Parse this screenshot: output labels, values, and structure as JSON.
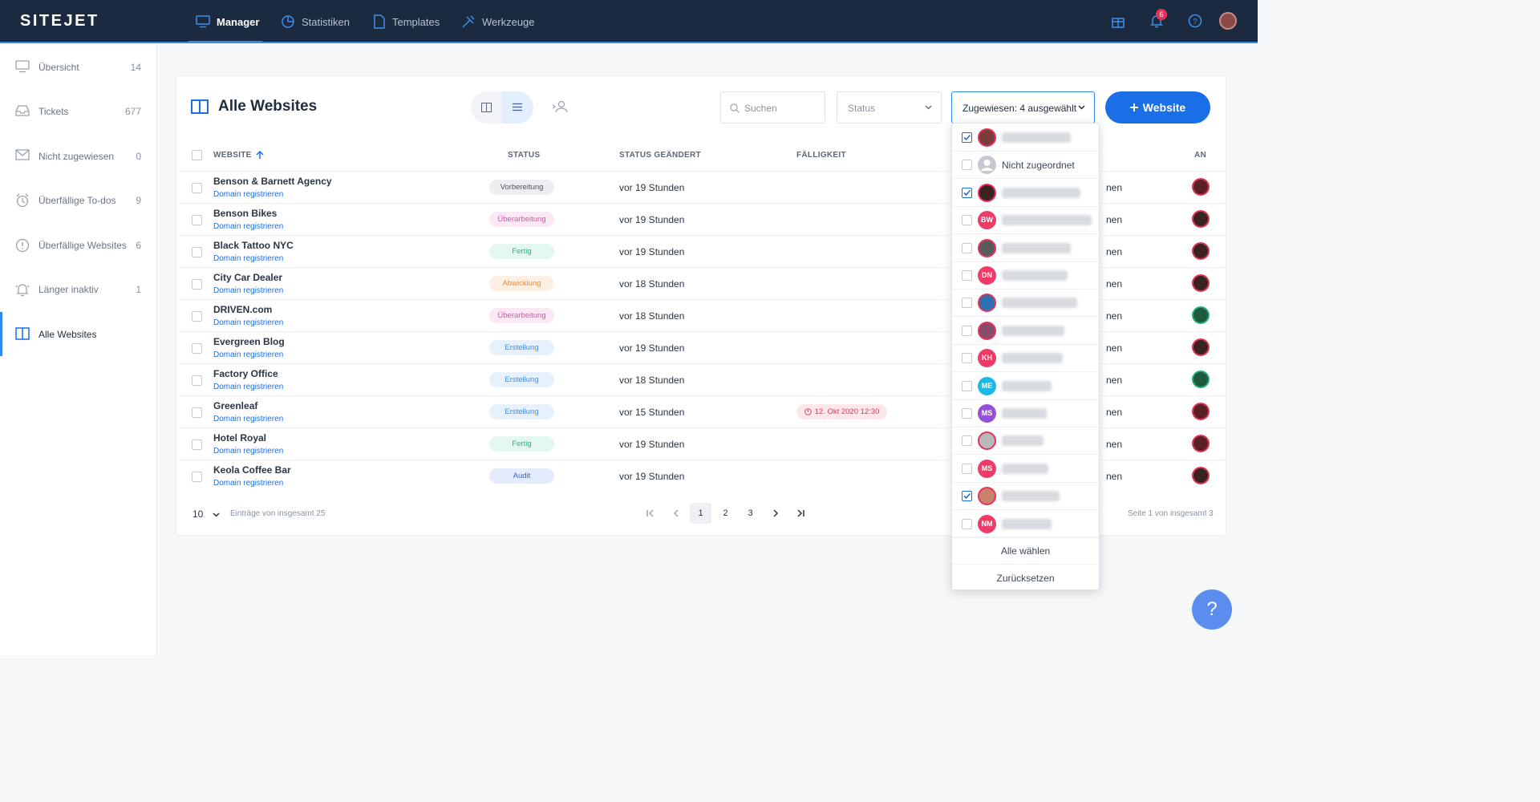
{
  "app": {
    "logo": "SITEJET"
  },
  "nav": [
    {
      "label": "Manager",
      "active": true
    },
    {
      "label": "Statistiken"
    },
    {
      "label": "Templates"
    },
    {
      "label": "Werkzeuge"
    }
  ],
  "header": {
    "notification_count": "6"
  },
  "sidebar": {
    "items": [
      {
        "label": "Übersicht",
        "count": "14",
        "icon": "monitor-icon"
      },
      {
        "label": "Tickets",
        "count": "677",
        "icon": "inbox-icon"
      },
      {
        "label": "Nicht zugewiesen",
        "count": "0",
        "icon": "mail-icon"
      },
      {
        "label": "Überfällige To-dos",
        "count": "9",
        "icon": "alarm-clock-icon"
      },
      {
        "label": "Überfällige Websites",
        "count": "6",
        "icon": "alert-circle-icon"
      },
      {
        "label": "Länger inaktiv",
        "count": "1",
        "icon": "bell-icon"
      },
      {
        "label": "Alle Websites",
        "count": "",
        "icon": "columns-icon",
        "active": true
      }
    ]
  },
  "main": {
    "title": "Alle Websites",
    "search_placeholder": "Suchen",
    "status_filter": "Status",
    "assign_filter": "Zugewiesen: 4 ausgewählt",
    "add_button": "Website",
    "columns": {
      "website": "WEBSITE",
      "status": "STATUS",
      "changed": "STATUS GEÄNDERT",
      "due": "FÄLLIGKEIT",
      "assigned": "AN"
    },
    "rows": [
      {
        "name": "Benson & Barnett Agency",
        "domain": "Domain registrieren",
        "status": "Vorbereitung",
        "changed": "vor 19 Stunden",
        "due": "",
        "partial": "nen"
      },
      {
        "name": "Benson Bikes",
        "domain": "Domain registrieren",
        "status": "Überarbeitung",
        "changed": "vor 19 Stunden",
        "due": "",
        "partial": "nen"
      },
      {
        "name": "Black Tattoo NYC",
        "domain": "Domain registrieren",
        "status": "Fertig",
        "changed": "vor 19 Stunden",
        "due": "",
        "partial": "nen"
      },
      {
        "name": "City Car Dealer",
        "domain": "Domain registrieren",
        "status": "Abwicklung",
        "changed": "vor 18 Stunden",
        "due": "",
        "partial": "nen"
      },
      {
        "name": "DRIVEN.com",
        "domain": "Domain registrieren",
        "status": "Überarbeitung",
        "changed": "vor 18 Stunden",
        "due": "",
        "partial": "nen"
      },
      {
        "name": "Evergreen Blog",
        "domain": "Domain registrieren",
        "status": "Erstellung",
        "changed": "vor 19 Stunden",
        "due": "",
        "partial": "nen"
      },
      {
        "name": "Factory Office",
        "domain": "Domain registrieren",
        "status": "Erstellung",
        "changed": "vor 18 Stunden",
        "due": "",
        "partial": "nen"
      },
      {
        "name": "Greenleaf",
        "domain": "Domain registrieren",
        "status": "Erstellung",
        "changed": "vor 15 Stunden",
        "due": "12. Okt 2020 12:30",
        "partial": "nen"
      },
      {
        "name": "Hotel Royal",
        "domain": "Domain registrieren",
        "status": "Fertig",
        "changed": "vor 19 Stunden",
        "due": "",
        "partial": "nen"
      },
      {
        "name": "Keola Coffee Bar",
        "domain": "Domain registrieren",
        "status": "Audit",
        "changed": "vor 19 Stunden",
        "due": "",
        "partial": "nen"
      }
    ],
    "pagination": {
      "per_page": "10",
      "total_text": "Einträge von insgesamt 25",
      "pages": [
        "1",
        "2",
        "3"
      ],
      "page_info": "Seite 1 von insgesamt 3"
    }
  },
  "status_colors": {
    "Vorbereitung": {
      "bg": "#eceef1",
      "fg": "#4a5461"
    },
    "Überarbeitung": {
      "bg": "#fce8f5",
      "fg": "#d94fb4"
    },
    "Fertig": {
      "bg": "#e3f7ee",
      "fg": "#27b47a"
    },
    "Abwicklung": {
      "bg": "#fdf0e3",
      "fg": "#ef8a2a"
    },
    "Erstellung": {
      "bg": "#e6f1fc",
      "fg": "#3a8fe0"
    },
    "Audit": {
      "bg": "#e4ebfc",
      "fg": "#2d63e0"
    }
  },
  "dropdown": {
    "items": [
      {
        "initials": "",
        "checked": true,
        "label": "",
        "color": "#7a3c3c"
      },
      {
        "initials": "",
        "checked": false,
        "label": "Nicht zugeordnet",
        "color": "#c5cad1"
      },
      {
        "initials": "",
        "checked": true,
        "label": "",
        "color": "#3a2320"
      },
      {
        "initials": "BW",
        "checked": false,
        "label": "",
        "color": "#ef3b68"
      },
      {
        "initials": "",
        "checked": false,
        "label": "",
        "color": "#5a5a5a"
      },
      {
        "initials": "DN",
        "checked": false,
        "label": "",
        "color": "#ef3b68"
      },
      {
        "initials": "",
        "checked": false,
        "label": "",
        "color": "#2d6fb0"
      },
      {
        "initials": "",
        "checked": false,
        "label": "",
        "color": "#8a4a6a"
      },
      {
        "initials": "KH",
        "checked": false,
        "label": "",
        "color": "#ef3b68"
      },
      {
        "initials": "ME",
        "checked": false,
        "label": "",
        "color": "#1cb8e6"
      },
      {
        "initials": "MS",
        "checked": false,
        "label": "",
        "color": "#9650d6"
      },
      {
        "initials": "",
        "checked": false,
        "label": "",
        "color": "#b9b9b9"
      },
      {
        "initials": "MS",
        "checked": false,
        "label": "",
        "color": "#ef3b68"
      },
      {
        "initials": "",
        "checked": true,
        "label": "",
        "color": "#c9836a"
      },
      {
        "initials": "NM",
        "checked": false,
        "label": "",
        "color": "#ef3b68"
      }
    ],
    "select_all": "Alle wählen",
    "reset": "Zurücksetzen"
  },
  "help": {
    "label": "?"
  }
}
